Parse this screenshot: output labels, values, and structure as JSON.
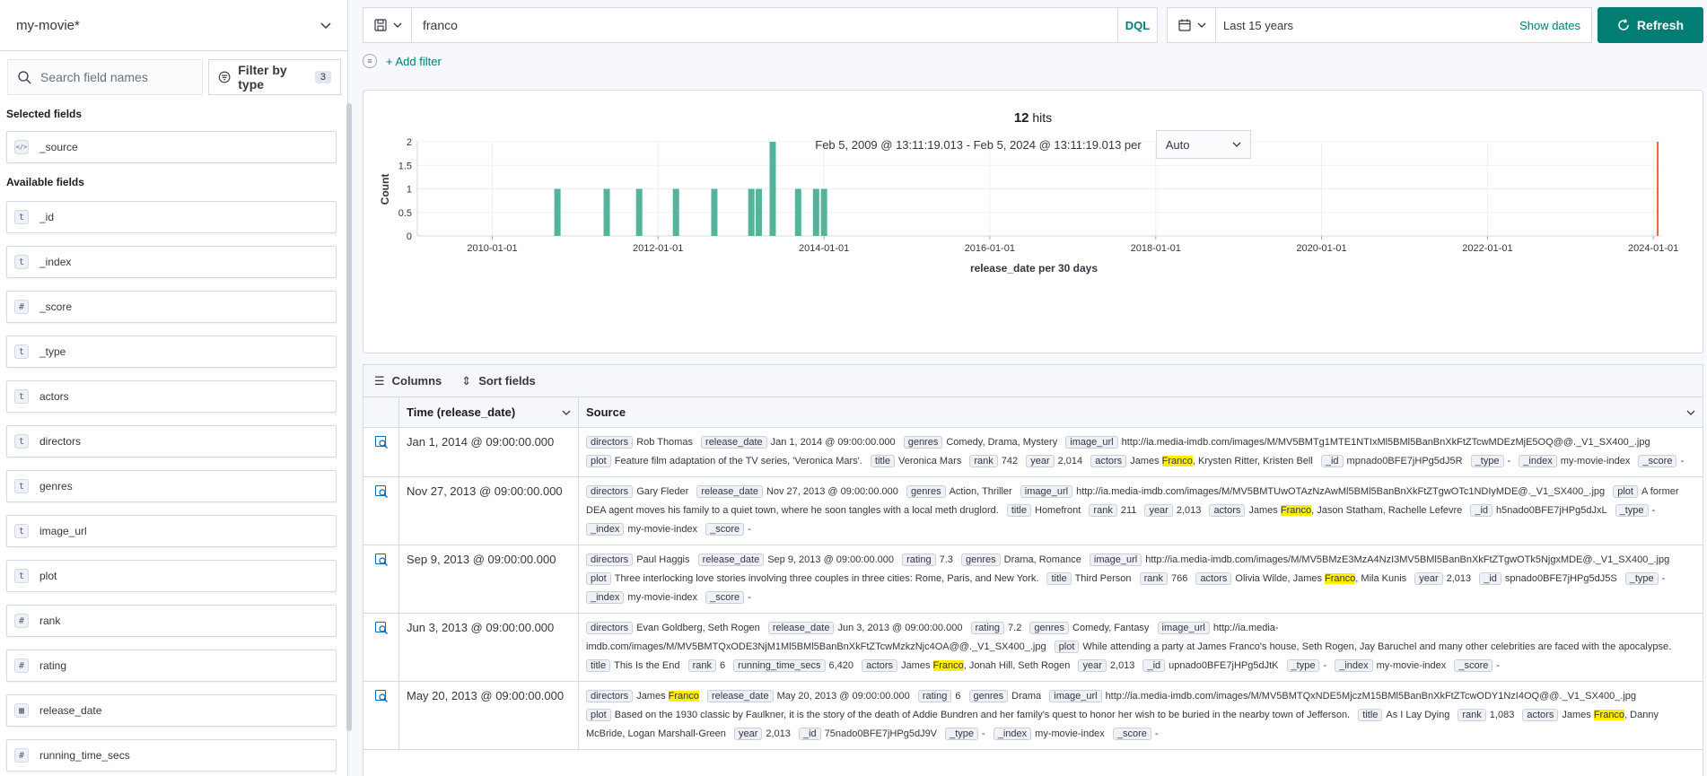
{
  "sidebar": {
    "index_pattern": "my-movie*",
    "search_placeholder": "Search field names",
    "filter_by_type_label": "Filter by type",
    "filter_count": "3",
    "selected_title": "Selected fields",
    "selected_fields": [
      {
        "type": "src",
        "name": "_source"
      }
    ],
    "available_title": "Available fields",
    "available_fields": [
      {
        "type": "t",
        "name": "_id"
      },
      {
        "type": "t",
        "name": "_index"
      },
      {
        "type": "#",
        "name": "_score"
      },
      {
        "type": "t",
        "name": "_type"
      },
      {
        "type": "t",
        "name": "actors"
      },
      {
        "type": "t",
        "name": "directors"
      },
      {
        "type": "t",
        "name": "genres"
      },
      {
        "type": "t",
        "name": "image_url"
      },
      {
        "type": "t",
        "name": "plot"
      },
      {
        "type": "#",
        "name": "rank"
      },
      {
        "type": "#",
        "name": "rating"
      },
      {
        "type": "date",
        "name": "release_date"
      },
      {
        "type": "#",
        "name": "running_time_secs"
      }
    ]
  },
  "topbar": {
    "query": "franco",
    "language": "DQL",
    "time_range": "Last 15 years",
    "show_dates": "Show dates",
    "refresh": "Refresh",
    "add_filter": "+ Add filter"
  },
  "chart_header": {
    "hits_count": "12",
    "hits_label": "hits",
    "date_range": "Feb 5, 2009 @ 13:11:19.013 - Feb 5, 2024 @ 13:11:19.013 per",
    "interval": "Auto"
  },
  "chart_data": {
    "type": "bar",
    "xlabel": "release_date per 30 days",
    "ylabel": "Count",
    "ylim": [
      0,
      2
    ],
    "yticks": [
      "0",
      "0.5",
      "1",
      "1.5",
      "2"
    ],
    "xticks": [
      "2010-01-01",
      "2012-01-01",
      "2014-01-01",
      "2016-01-01",
      "2018-01-01",
      "2020-01-01",
      "2022-01-01",
      "2024-01-01"
    ],
    "x_start": "2009-02-05",
    "x_end": "2024-02-05",
    "values": [
      {
        "date": "2010-10-15",
        "count": 1
      },
      {
        "date": "2011-05-20",
        "count": 1
      },
      {
        "date": "2011-10-10",
        "count": 1
      },
      {
        "date": "2012-03-20",
        "count": 1
      },
      {
        "date": "2012-09-05",
        "count": 1
      },
      {
        "date": "2013-02-15",
        "count": 1
      },
      {
        "date": "2013-03-20",
        "count": 1
      },
      {
        "date": "2013-05-20",
        "count": 2
      },
      {
        "date": "2013-09-09",
        "count": 1
      },
      {
        "date": "2013-11-27",
        "count": 1
      },
      {
        "date": "2014-01-01",
        "count": 1
      }
    ],
    "now_marker_date": "2024-02-05",
    "bar_color": "#54b399",
    "marker_color": "#e7664c"
  },
  "table": {
    "columns_btn": "Columns",
    "sort_btn": "Sort fields",
    "col_time": "Time (release_date)",
    "col_source": "Source",
    "rows": [
      {
        "time": "Jan 1, 2014 @ 09:00:00.000",
        "fields": [
          [
            "directors",
            "Rob Thomas"
          ],
          [
            "release_date",
            "Jan 1, 2014 @ 09:00:00.000"
          ],
          [
            "genres",
            "Comedy, Drama, Mystery"
          ],
          [
            "image_url",
            "http://ia.media-imdb.com/images/M/MV5BMTg1MTE1NTIxMl5BMl5BanBnXkFtZTcwMDEzMjE5OQ@@._V1_SX400_.jpg"
          ],
          [
            "plot",
            "Feature film adaptation of the TV series, 'Veronica Mars'."
          ],
          [
            "title",
            "Veronica Mars"
          ],
          [
            "rank",
            "742"
          ],
          [
            "year",
            "2,014"
          ],
          [
            "actors",
            "James |Franco|, Krysten Ritter, Kristen Bell"
          ],
          [
            "_id",
            "mpnado0BFE7jHPg5dJ5R"
          ],
          [
            "_type",
            "-"
          ],
          [
            "_index",
            "my-movie-index"
          ],
          [
            "_score",
            "-"
          ]
        ]
      },
      {
        "time": "Nov 27, 2013 @ 09:00:00.000",
        "fields": [
          [
            "directors",
            "Gary Fleder"
          ],
          [
            "release_date",
            "Nov 27, 2013 @ 09:00:00.000"
          ],
          [
            "genres",
            "Action, Thriller"
          ],
          [
            "image_url",
            "http://ia.media-imdb.com/images/M/MV5BMTUwOTAzNzAwMl5BMl5BanBnXkFtZTgwOTc1NDIyMDE@._V1_SX400_.jpg"
          ],
          [
            "plot",
            "A former DEA agent moves his family to a quiet town, where he soon tangles with a local meth druglord."
          ],
          [
            "title",
            "Homefront"
          ],
          [
            "rank",
            "211"
          ],
          [
            "year",
            "2,013"
          ],
          [
            "actors",
            "James |Franco|, Jason Statham, Rachelle Lefevre"
          ],
          [
            "_id",
            "h5nado0BFE7jHPg5dJxL"
          ],
          [
            "_type",
            "-"
          ],
          [
            "_index",
            "my-movie-index"
          ],
          [
            "_score",
            "-"
          ]
        ]
      },
      {
        "time": "Sep 9, 2013 @ 09:00:00.000",
        "fields": [
          [
            "directors",
            "Paul Haggis"
          ],
          [
            "release_date",
            "Sep 9, 2013 @ 09:00:00.000"
          ],
          [
            "rating",
            "7.3"
          ],
          [
            "genres",
            "Drama, Romance"
          ],
          [
            "image_url",
            "http://ia.media-imdb.com/images/M/MV5BMzE3MzA4NzI3MV5BMl5BanBnXkFtZTgwOTk5NjgxMDE@._V1_SX400_.jpg"
          ],
          [
            "plot",
            "Three interlocking love stories involving three couples in three cities: Rome, Paris, and New York."
          ],
          [
            "title",
            "Third Person"
          ],
          [
            "rank",
            "766"
          ],
          [
            "actors",
            "Olivia Wilde, James |Franco|, Mila Kunis"
          ],
          [
            "year",
            "2,013"
          ],
          [
            "_id",
            "spnado0BFE7jHPg5dJ5S"
          ],
          [
            "_type",
            "-"
          ],
          [
            "_index",
            "my-movie-index"
          ],
          [
            "_score",
            "-"
          ]
        ]
      },
      {
        "time": "Jun 3, 2013 @ 09:00:00.000",
        "fields": [
          [
            "directors",
            "Evan Goldberg, Seth Rogen"
          ],
          [
            "release_date",
            "Jun 3, 2013 @ 09:00:00.000"
          ],
          [
            "rating",
            "7.2"
          ],
          [
            "genres",
            "Comedy, Fantasy"
          ],
          [
            "image_url",
            "http://ia.media-imdb.com/images/M/MV5BMTQxODE3NjM1Ml5BMl5BanBnXkFtZTcwMzkzNjc4OA@@._V1_SX400_.jpg"
          ],
          [
            "plot",
            "While attending a party at James Franco's house, Seth Rogen, Jay Baruchel and many other celebrities are faced with the apocalypse."
          ],
          [
            "title",
            "This Is the End"
          ],
          [
            "rank",
            "6"
          ],
          [
            "running_time_secs",
            "6,420"
          ],
          [
            "actors",
            "James |Franco|, Jonah Hill, Seth Rogen"
          ],
          [
            "year",
            "2,013"
          ],
          [
            "_id",
            "upnado0BFE7jHPg5dJtK"
          ],
          [
            "_type",
            "-"
          ],
          [
            "_index",
            "my-movie-index"
          ],
          [
            "_score",
            "-"
          ]
        ]
      },
      {
        "time": "May 20, 2013 @ 09:00:00.000",
        "fields": [
          [
            "directors",
            "James |Franco|"
          ],
          [
            "release_date",
            "May 20, 2013 @ 09:00:00.000"
          ],
          [
            "rating",
            "6"
          ],
          [
            "genres",
            "Drama"
          ],
          [
            "image_url",
            "http://ia.media-imdb.com/images/M/MV5BMTQxNDE5MjczM15BMl5BanBnXkFtZTcwODY1NzI4OQ@@._V1_SX400_.jpg"
          ],
          [
            "plot",
            "Based on the 1930 classic by Faulkner, it is the story of the death of Addie Bundren and her family's quest to honor her wish to be buried in the nearby town of Jefferson."
          ],
          [
            "title",
            "As I Lay Dying"
          ],
          [
            "rank",
            "1,083"
          ],
          [
            "actors",
            "James |Franco|, Danny McBride, Logan Marshall-Green"
          ],
          [
            "year",
            "2,013"
          ],
          [
            "_id",
            "75nado0BFE7jHPg5dJ9V"
          ],
          [
            "_type",
            "-"
          ],
          [
            "_index",
            "my-movie-index"
          ],
          [
            "_score",
            "-"
          ]
        ]
      }
    ]
  }
}
